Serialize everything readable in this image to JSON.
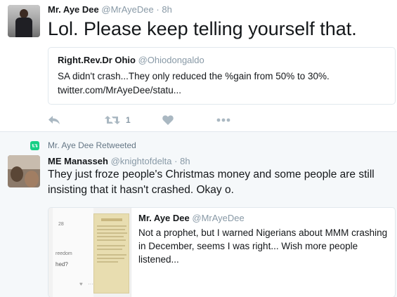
{
  "tweet1": {
    "author_name": "Mr. Aye Dee",
    "author_handle": "@MrAyeDee",
    "separator": "·",
    "time": "8h",
    "text": "Lol. Please keep telling yourself that.",
    "quoted": {
      "author_name": "Right.Rev.Dr Ohio",
      "author_handle": "@Ohiodongaldo",
      "text_line1": "SA didn't crash...They only reduced the %gain from 50% to 30%.",
      "text_line2": "twitter.com/MrAyeDee/statu..."
    },
    "actions": {
      "reply_icon": "reply-icon",
      "retweet_icon": "retweet-icon",
      "retweet_count": "1",
      "like_icon": "heart-icon",
      "more_icon": "more-dots-icon"
    }
  },
  "tweet2": {
    "retweet_context": "Mr. Aye Dee Retweeted",
    "author_name": "ME Manasseh",
    "author_handle": "@knightofdelta",
    "separator": "·",
    "time": "8h",
    "text": "They just froze people's Christmas money and some people are still insisting that it hasn't crashed. Okay o.",
    "quoted": {
      "author_name": "Mr. Aye Dee",
      "author_handle": "@MrAyeDee",
      "text": "Not a prophet, but I warned Nigerians about MMM crashing in December, seems I was right...  Wish more people listened...",
      "thumb_text_date": "28",
      "thumb_text_freedom": "reedom",
      "thumb_text_crash": "hed?"
    }
  },
  "colors": {
    "text": "#14171a",
    "muted": "#8899a6",
    "border": "#e1e8ed",
    "retweet_green": "#19cf86",
    "action_gray": "#aab8c2",
    "highlight_bg": "#f5f8fa"
  }
}
